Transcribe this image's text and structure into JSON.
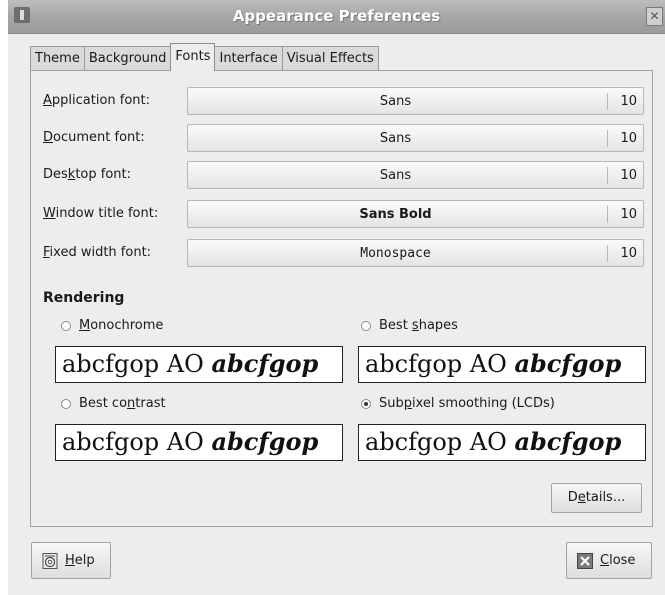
{
  "window": {
    "title": "Appearance Preferences",
    "close_glyph": "✕"
  },
  "tabs": [
    {
      "label": "Theme"
    },
    {
      "label": "Background"
    },
    {
      "label": "Fonts",
      "active": true
    },
    {
      "label": "Interface"
    },
    {
      "label": "Visual Effects"
    }
  ],
  "fonts": {
    "application": {
      "label_mnemonic": "A",
      "label_rest": "pplication font:",
      "family": "Sans",
      "size": "10"
    },
    "document": {
      "label_mnemonic": "D",
      "label_rest": "ocument font:",
      "family": "Sans",
      "size": "10"
    },
    "desktop": {
      "label_pre": "Des",
      "label_mnemonic": "k",
      "label_rest": "top font:",
      "family": "Sans",
      "size": "10"
    },
    "window_title": {
      "label_mnemonic": "W",
      "label_rest": "indow title font:",
      "family": "Sans Bold",
      "size": "10"
    },
    "fixed_width": {
      "label_mnemonic": "F",
      "label_rest": "ixed width font:",
      "family": "Monospace",
      "size": "10"
    }
  },
  "rendering": {
    "title": "Rendering",
    "sample_text": "abcfgop AO",
    "sample_emphasis": "abcfgop",
    "options": {
      "monochrome": {
        "mnemonic": "M",
        "rest": "onochrome",
        "selected": false
      },
      "best_shapes": {
        "pre": "Best ",
        "mnemonic": "s",
        "rest": "hapes",
        "selected": false
      },
      "best_contrast": {
        "pre": "Best co",
        "mnemonic": "n",
        "rest": "trast",
        "selected": false
      },
      "subpixel": {
        "pre": "Sub",
        "mnemonic": "p",
        "rest": "ixel smoothing (LCDs)",
        "selected": true
      }
    }
  },
  "buttons": {
    "details": {
      "pre": "D",
      "mnemonic": "e",
      "rest": "tails..."
    },
    "help": {
      "mnemonic": "H",
      "rest": "elp",
      "icon": "help-icon"
    },
    "close": {
      "mnemonic": "C",
      "rest": "lose",
      "icon": "close-icon"
    }
  }
}
